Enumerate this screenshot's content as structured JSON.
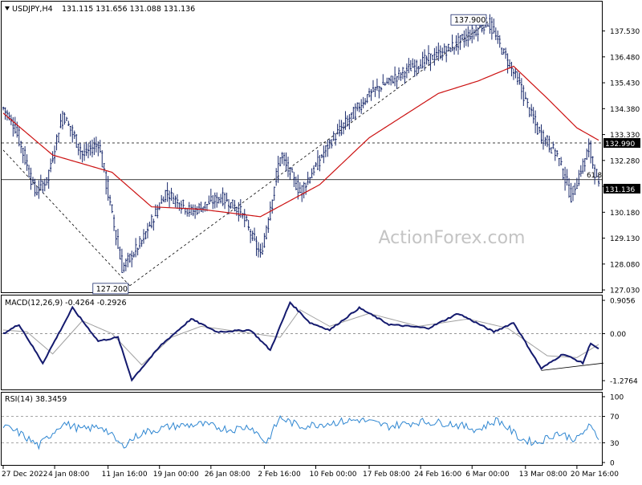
{
  "header": {
    "symbol": "USDJPY,H4",
    "ohlc": "131.115 131.656 131.088 131.136",
    "watermark": "ActionForex.com"
  },
  "colors": {
    "bg": "#ffffff",
    "frame": "#000000",
    "candle": "#1a2a6c",
    "ma": "#cc1111",
    "macd": "#141a6e",
    "signal": "#a0a0a0",
    "rsi": "#2e86d1",
    "trend": "#000000",
    "watermark": "#c4c4c4",
    "price_tag_bg": "#000000",
    "price_tag_fg": "#ffffff"
  },
  "chart_data": [
    {
      "type": "candlestick",
      "title": "USDJPY,H4",
      "ylim": [
        127.0,
        138.2
      ],
      "y_ticks": [
        "137.530",
        "136.480",
        "135.430",
        "134.380",
        "133.330",
        "132.280",
        "131.230",
        "130.180",
        "129.130",
        "128.080",
        "127.030"
      ],
      "x_ticks": [
        "27 Dec 2022",
        "4 Jan 08:00",
        "11 Jan 16:00",
        "19 Jan 00:00",
        "26 Jan 08:00",
        "2 Feb 16:00",
        "10 Feb 00:00",
        "17 Feb 08:00",
        "24 Feb 16:00",
        "6 Mar 00:00",
        "13 Mar 08:00",
        "20 Mar 16:00"
      ],
      "anchors": [
        {
          "bar": 0,
          "close": 134.4
        },
        {
          "bar": 6,
          "close": 133.6
        },
        {
          "bar": 16,
          "close": 131.0
        },
        {
          "bar": 22,
          "close": 131.5
        },
        {
          "bar": 30,
          "close": 134.2
        },
        {
          "bar": 40,
          "close": 132.5
        },
        {
          "bar": 48,
          "close": 133.0
        },
        {
          "bar": 60,
          "close": 127.9
        },
        {
          "bar": 70,
          "close": 129.0
        },
        {
          "bar": 82,
          "close": 131.0
        },
        {
          "bar": 95,
          "close": 130.2
        },
        {
          "bar": 110,
          "close": 130.8
        },
        {
          "bar": 120,
          "close": 130.2
        },
        {
          "bar": 130,
          "close": 128.4
        },
        {
          "bar": 140,
          "close": 132.5
        },
        {
          "bar": 150,
          "close": 131.0
        },
        {
          "bar": 165,
          "close": 133.0
        },
        {
          "bar": 185,
          "close": 135.0
        },
        {
          "bar": 205,
          "close": 136.0
        },
        {
          "bar": 225,
          "close": 136.8
        },
        {
          "bar": 245,
          "close": 137.9
        },
        {
          "bar": 260,
          "close": 135.5
        },
        {
          "bar": 270,
          "close": 133.5
        },
        {
          "bar": 280,
          "close": 132.5
        },
        {
          "bar": 287,
          "close": 130.8
        },
        {
          "bar": 296,
          "close": 132.8
        },
        {
          "bar": 301,
          "close": 131.136
        }
      ],
      "moving_average_anchors": [
        {
          "bar": 0,
          "value": 134.2
        },
        {
          "bar": 25,
          "value": 132.5
        },
        {
          "bar": 55,
          "value": 131.8
        },
        {
          "bar": 75,
          "value": 130.4
        },
        {
          "bar": 100,
          "value": 130.3
        },
        {
          "bar": 130,
          "value": 130.0
        },
        {
          "bar": 160,
          "value": 131.3
        },
        {
          "bar": 185,
          "value": 133.2
        },
        {
          "bar": 220,
          "value": 135.0
        },
        {
          "bar": 240,
          "value": 135.5
        },
        {
          "bar": 258,
          "value": 136.1
        },
        {
          "bar": 275,
          "value": 134.8
        },
        {
          "bar": 290,
          "value": 133.6
        },
        {
          "bar": 301,
          "value": 133.1
        }
      ],
      "annotations": [
        {
          "label": "137.900",
          "bar": 245,
          "price": 137.9,
          "box": true
        },
        {
          "label": "127.200",
          "bar": 64,
          "price": 127.2,
          "box": true
        },
        {
          "label": "61.8",
          "bar": 299,
          "price": 131.5,
          "box": false
        }
      ],
      "horizontal_lines": [
        {
          "price": 132.99,
          "label": "132.990",
          "style": "dashed"
        },
        {
          "price": 131.5,
          "style": "solid"
        }
      ],
      "trendlines": [
        {
          "from": {
            "bar": 0,
            "price": 132.7
          },
          "to": {
            "bar": 64,
            "price": 127.2
          },
          "style": "dashed"
        },
        {
          "from": {
            "bar": 64,
            "price": 127.2
          },
          "to": {
            "bar": 245,
            "price": 137.9
          },
          "style": "dashed"
        }
      ],
      "current_price": {
        "value": 131.136,
        "label": "131.136"
      }
    },
    {
      "type": "line",
      "title": "MACD(12,26,9) -0.4264 -0.2926",
      "ylim": [
        -1.45,
        0.95
      ],
      "y_ticks": [
        "0.9056",
        "0.00",
        "-1.2764"
      ],
      "zero_line": 0.0,
      "macd_anchors": [
        {
          "bar": 0,
          "value": 0.0
        },
        {
          "bar": 8,
          "value": 0.25
        },
        {
          "bar": 20,
          "value": -0.8
        },
        {
          "bar": 35,
          "value": 0.7
        },
        {
          "bar": 48,
          "value": -0.2
        },
        {
          "bar": 58,
          "value": -0.1
        },
        {
          "bar": 65,
          "value": -1.25
        },
        {
          "bar": 80,
          "value": -0.3
        },
        {
          "bar": 95,
          "value": 0.4
        },
        {
          "bar": 108,
          "value": 0.05
        },
        {
          "bar": 125,
          "value": 0.1
        },
        {
          "bar": 135,
          "value": -0.45
        },
        {
          "bar": 145,
          "value": 0.85
        },
        {
          "bar": 155,
          "value": 0.3
        },
        {
          "bar": 165,
          "value": 0.1
        },
        {
          "bar": 180,
          "value": 0.7
        },
        {
          "bar": 195,
          "value": 0.25
        },
        {
          "bar": 215,
          "value": 0.15
        },
        {
          "bar": 230,
          "value": 0.55
        },
        {
          "bar": 248,
          "value": 0.05
        },
        {
          "bar": 258,
          "value": 0.3
        },
        {
          "bar": 272,
          "value": -0.95
        },
        {
          "bar": 283,
          "value": -0.55
        },
        {
          "bar": 293,
          "value": -0.8
        },
        {
          "bar": 297,
          "value": -0.25
        },
        {
          "bar": 301,
          "value": -0.4264
        }
      ],
      "signal_anchors": [
        {
          "bar": 0,
          "value": 0.1
        },
        {
          "bar": 12,
          "value": 0.05
        },
        {
          "bar": 25,
          "value": -0.55
        },
        {
          "bar": 40,
          "value": 0.35
        },
        {
          "bar": 55,
          "value": 0.0
        },
        {
          "bar": 70,
          "value": -0.85
        },
        {
          "bar": 85,
          "value": -0.1
        },
        {
          "bar": 100,
          "value": 0.2
        },
        {
          "bar": 120,
          "value": 0.05
        },
        {
          "bar": 140,
          "value": -0.1
        },
        {
          "bar": 150,
          "value": 0.65
        },
        {
          "bar": 165,
          "value": 0.2
        },
        {
          "bar": 185,
          "value": 0.55
        },
        {
          "bar": 210,
          "value": 0.2
        },
        {
          "bar": 235,
          "value": 0.4
        },
        {
          "bar": 255,
          "value": 0.15
        },
        {
          "bar": 275,
          "value": -0.6
        },
        {
          "bar": 290,
          "value": -0.65
        },
        {
          "bar": 301,
          "value": -0.2926
        }
      ],
      "divergence_line": {
        "from": {
          "bar": 272,
          "value": -1.0
        },
        "to": {
          "bar": 301,
          "value": -0.8
        }
      }
    },
    {
      "type": "line",
      "title": "RSI(14) 38.3459",
      "ylim": [
        0,
        100
      ],
      "y_ticks": [
        "100",
        "70",
        "30",
        "0"
      ],
      "levels": [
        70,
        30
      ],
      "rsi_anchors": [
        {
          "bar": 0,
          "value": 55
        },
        {
          "bar": 8,
          "value": 45
        },
        {
          "bar": 18,
          "value": 25
        },
        {
          "bar": 30,
          "value": 60
        },
        {
          "bar": 40,
          "value": 50
        },
        {
          "bar": 50,
          "value": 55
        },
        {
          "bar": 60,
          "value": 25
        },
        {
          "bar": 70,
          "value": 45
        },
        {
          "bar": 85,
          "value": 55
        },
        {
          "bar": 100,
          "value": 58
        },
        {
          "bar": 115,
          "value": 50
        },
        {
          "bar": 125,
          "value": 55
        },
        {
          "bar": 133,
          "value": 30
        },
        {
          "bar": 140,
          "value": 68
        },
        {
          "bar": 150,
          "value": 55
        },
        {
          "bar": 165,
          "value": 60
        },
        {
          "bar": 180,
          "value": 65
        },
        {
          "bar": 195,
          "value": 55
        },
        {
          "bar": 210,
          "value": 62
        },
        {
          "bar": 225,
          "value": 60
        },
        {
          "bar": 240,
          "value": 50
        },
        {
          "bar": 250,
          "value": 65
        },
        {
          "bar": 262,
          "value": 35
        },
        {
          "bar": 270,
          "value": 30
        },
        {
          "bar": 280,
          "value": 45
        },
        {
          "bar": 290,
          "value": 35
        },
        {
          "bar": 296,
          "value": 55
        },
        {
          "bar": 301,
          "value": 38.3459
        }
      ]
    }
  ]
}
